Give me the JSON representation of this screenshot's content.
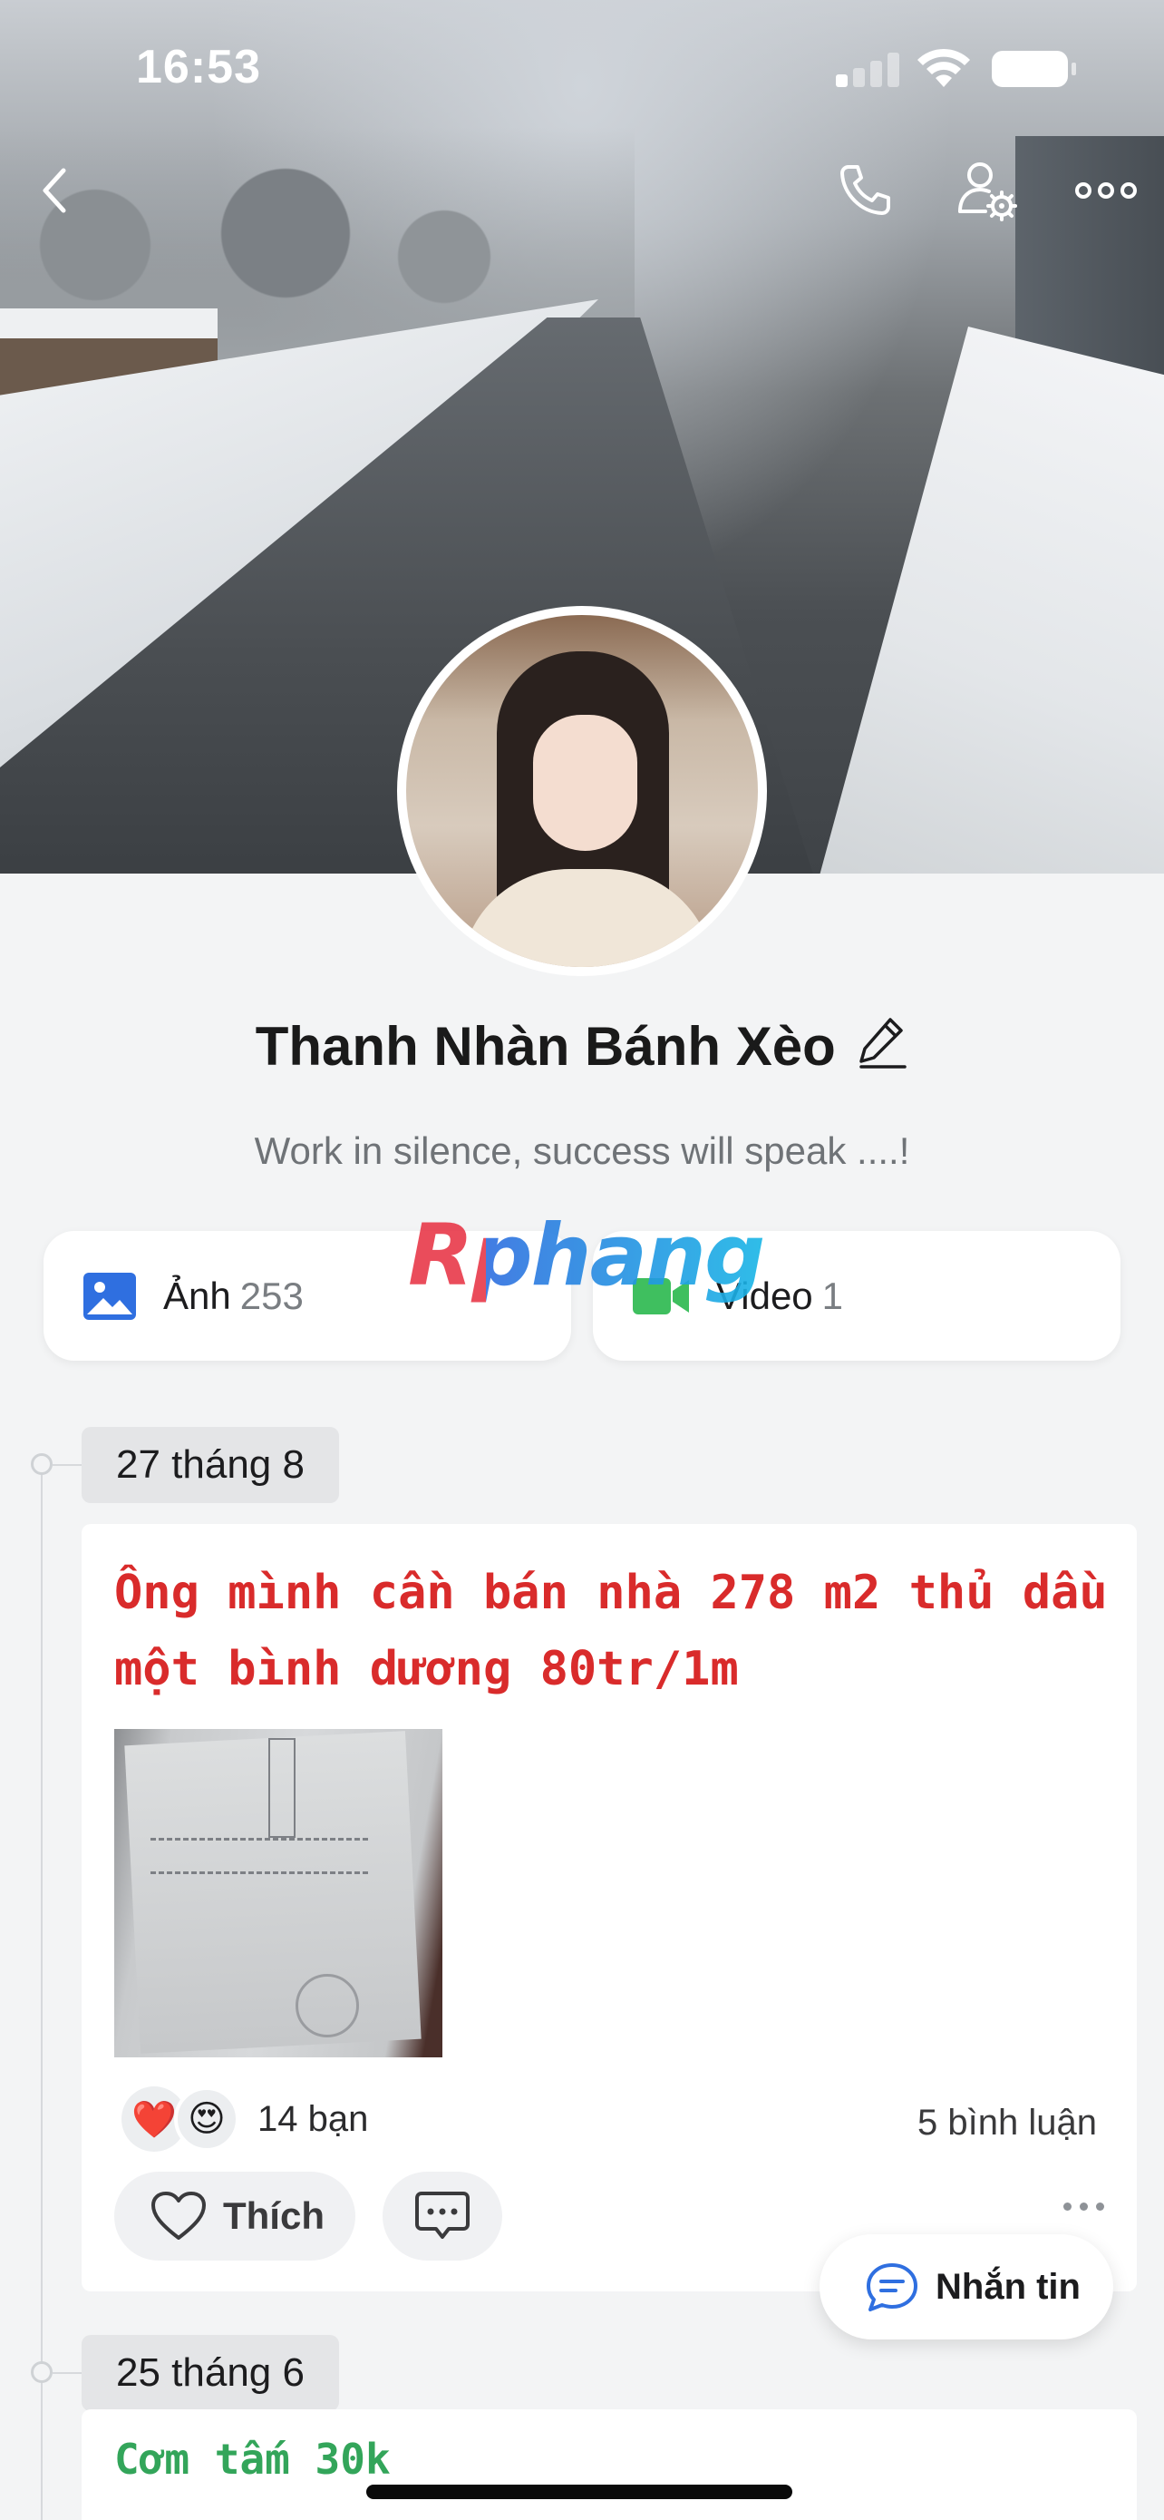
{
  "status_bar": {
    "time": "16:53"
  },
  "profile": {
    "name": "Thanh Nhàn Bánh Xèo",
    "bio": "Work in silence, success will speak ....!"
  },
  "media": {
    "photos": {
      "label": "Ảnh",
      "count": "253",
      "icon": "image-icon"
    },
    "videos": {
      "label": "Video",
      "count": "1",
      "icon": "video-camera-icon"
    }
  },
  "watermark": "Rphang",
  "timeline": [
    {
      "date": "27 tháng 8",
      "text": "Ông mình cần bán nhà 278 m2 thủ dầu một bình dương 80tr/1m",
      "reactions": [
        "❤️",
        "😍"
      ],
      "reaction_summary": "14 bạn",
      "comments": "5 bình luận",
      "like_label": "Thích"
    },
    {
      "date": "25 tháng 6",
      "text": "Cơm tấm 30k"
    }
  ],
  "fab": {
    "label": "Nhắn tin"
  },
  "colors": {
    "post_red": "#d92b2b",
    "post_green": "#33a55a",
    "accent_blue": "#2f6fe0",
    "video_green": "#3fbf5f"
  }
}
